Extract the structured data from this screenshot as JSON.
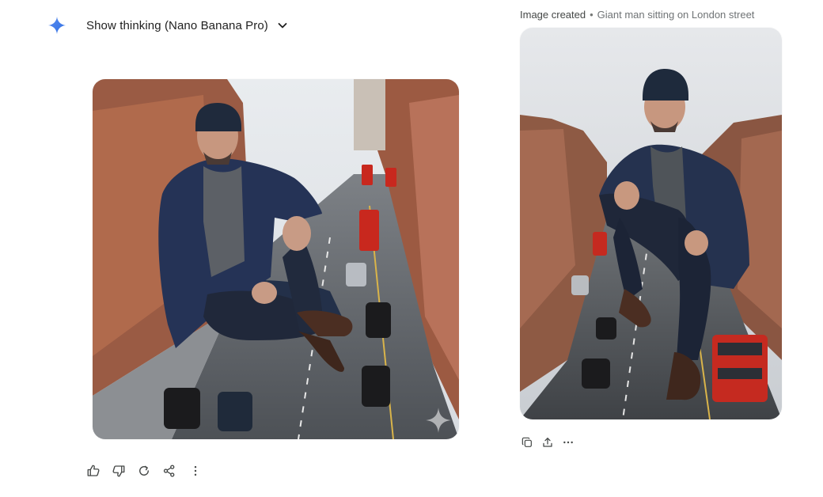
{
  "header": {
    "thinking_label": "Show thinking (Nano Banana Pro)",
    "icons": [
      "gemini-spark-icon",
      "chevron-down-icon"
    ]
  },
  "caption": {
    "label": "Image created",
    "separator": "•",
    "description": "Giant man sitting on London street"
  },
  "actions": {
    "response": [
      "thumbs-up-icon",
      "thumbs-down-icon",
      "redo-icon",
      "share-icon",
      "more-vertical-icon"
    ],
    "image": [
      "copy-icon",
      "upload-icon",
      "more-horizontal-icon"
    ]
  },
  "colors": {
    "accent": "#4285f4",
    "icon": "#444746",
    "text": "#1f1f1f",
    "muted": "#6f7375"
  }
}
